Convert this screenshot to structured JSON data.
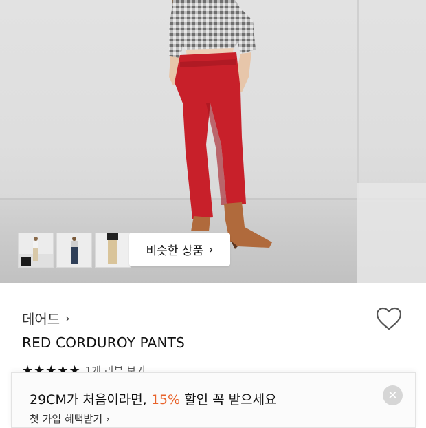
{
  "gallery": {
    "similar_button_label": "비슷한 상품",
    "similar_button_chevron": "›",
    "thumbnails": [
      "thumbnail-1",
      "thumbnail-2",
      "thumbnail-3"
    ]
  },
  "product": {
    "brand": "데어드",
    "brand_chevron": "›",
    "name": "RED CORDUROY PANTS",
    "stars": "★★★★★",
    "review_link": "1개 리뷰 보기",
    "wishlist_icon": "heart-outline-icon"
  },
  "promo": {
    "title_prefix": "29CM가 처음이라면, ",
    "title_percent": "15%",
    "title_suffix": " 할인 꼭 받으세요",
    "sub_label": "첫 가입 혜택받기",
    "sub_chevron": "›",
    "close_icon": "close-icon"
  },
  "colors": {
    "accent": "#e8622a",
    "pants": "#c8202a"
  }
}
